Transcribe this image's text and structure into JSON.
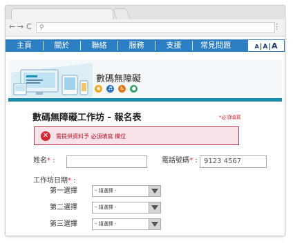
{
  "menu": {
    "items": [
      "主頁",
      "關於",
      "聯絡",
      "服務",
      "支援",
      "常見問題"
    ],
    "font_size": [
      "A",
      "A",
      "A"
    ]
  },
  "banner": {
    "site_title": "數碼無障礙"
  },
  "form": {
    "title": "數碼無障礙工作坊 - 報名表",
    "required_note": "*必須填寫",
    "error": "需提供資料予 必須填寫 欄位",
    "name_label": "姓名",
    "name_value": "",
    "phone_label": "電話號碼",
    "phone_value": "9123 4567",
    "date_label": "工作坊日期",
    "asterisk": "*",
    "colon": ":",
    "choices": [
      {
        "label": "第一選擇",
        "value": "- 請選擇 -"
      },
      {
        "label": "第二選擇",
        "value": "- 請選擇 -"
      },
      {
        "label": "第三選擇",
        "value": "- 請選擇 -"
      }
    ]
  },
  "colors": {
    "menu_bar": "#2d7fc4",
    "error_border": "#c2334b",
    "error_bg": "#f8e3e9",
    "required": "#d9262d"
  }
}
